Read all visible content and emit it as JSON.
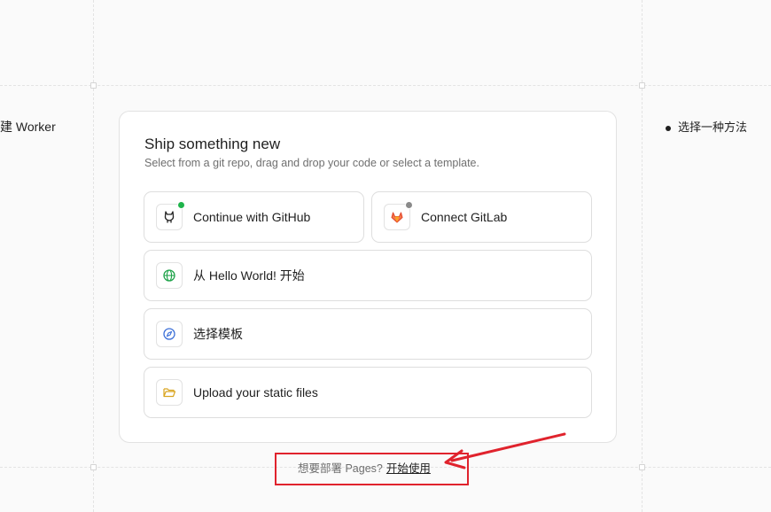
{
  "left_label": "建 Worker",
  "right_label": "选择一种方法",
  "card": {
    "title": "Ship something new",
    "subtitle": "Select from a git repo, drag and drop your code or select a template."
  },
  "options": {
    "github": {
      "label": "Continue with GitHub",
      "status_color": "#1fb44b"
    },
    "gitlab": {
      "label": "Connect GitLab",
      "status_color": "#8a8a8a"
    },
    "hello": {
      "label": "从 Hello World! 开始"
    },
    "template": {
      "label": "选择模板"
    },
    "upload": {
      "label": "Upload your static files"
    }
  },
  "footer": {
    "prompt": "想要部署 Pages?",
    "link": "开始使用"
  },
  "colors": {
    "annotation": "#e0232d",
    "github_status": "#1fb44b",
    "gitlab_status": "#8a8a8a"
  }
}
